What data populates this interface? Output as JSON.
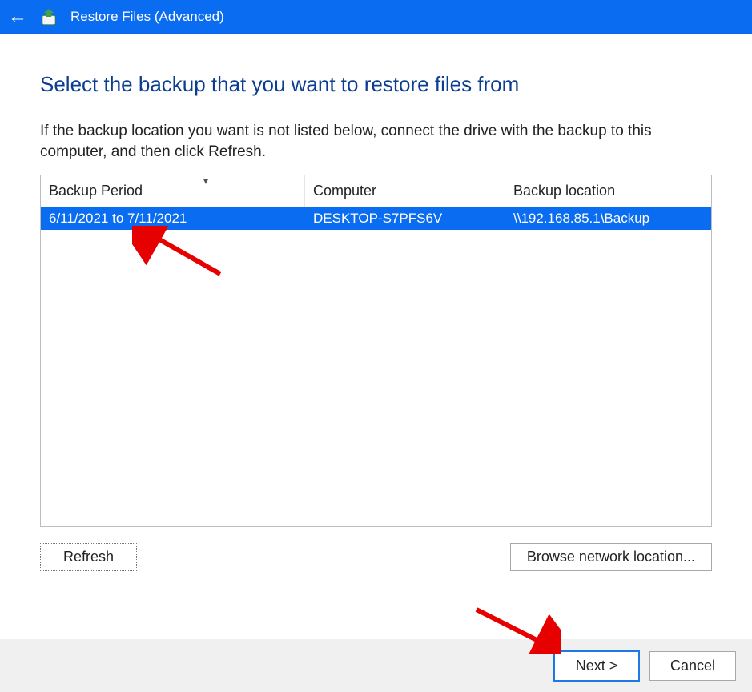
{
  "titlebar": {
    "title": "Restore Files (Advanced)"
  },
  "main": {
    "heading": "Select the backup that you want to restore files from",
    "description": "If the backup location you want is not listed below, connect the drive with the backup to this computer, and then click Refresh."
  },
  "table": {
    "headers": {
      "period": "Backup Period",
      "computer": "Computer",
      "location": "Backup location"
    },
    "rows": [
      {
        "period": "6/11/2021 to 7/11/2021",
        "computer": "DESKTOP-S7PFS6V",
        "location": "\\\\192.168.85.1\\Backup"
      }
    ]
  },
  "buttons": {
    "refresh": "Refresh",
    "browse": "Browse network location...",
    "next": "Next >",
    "cancel": "Cancel"
  }
}
